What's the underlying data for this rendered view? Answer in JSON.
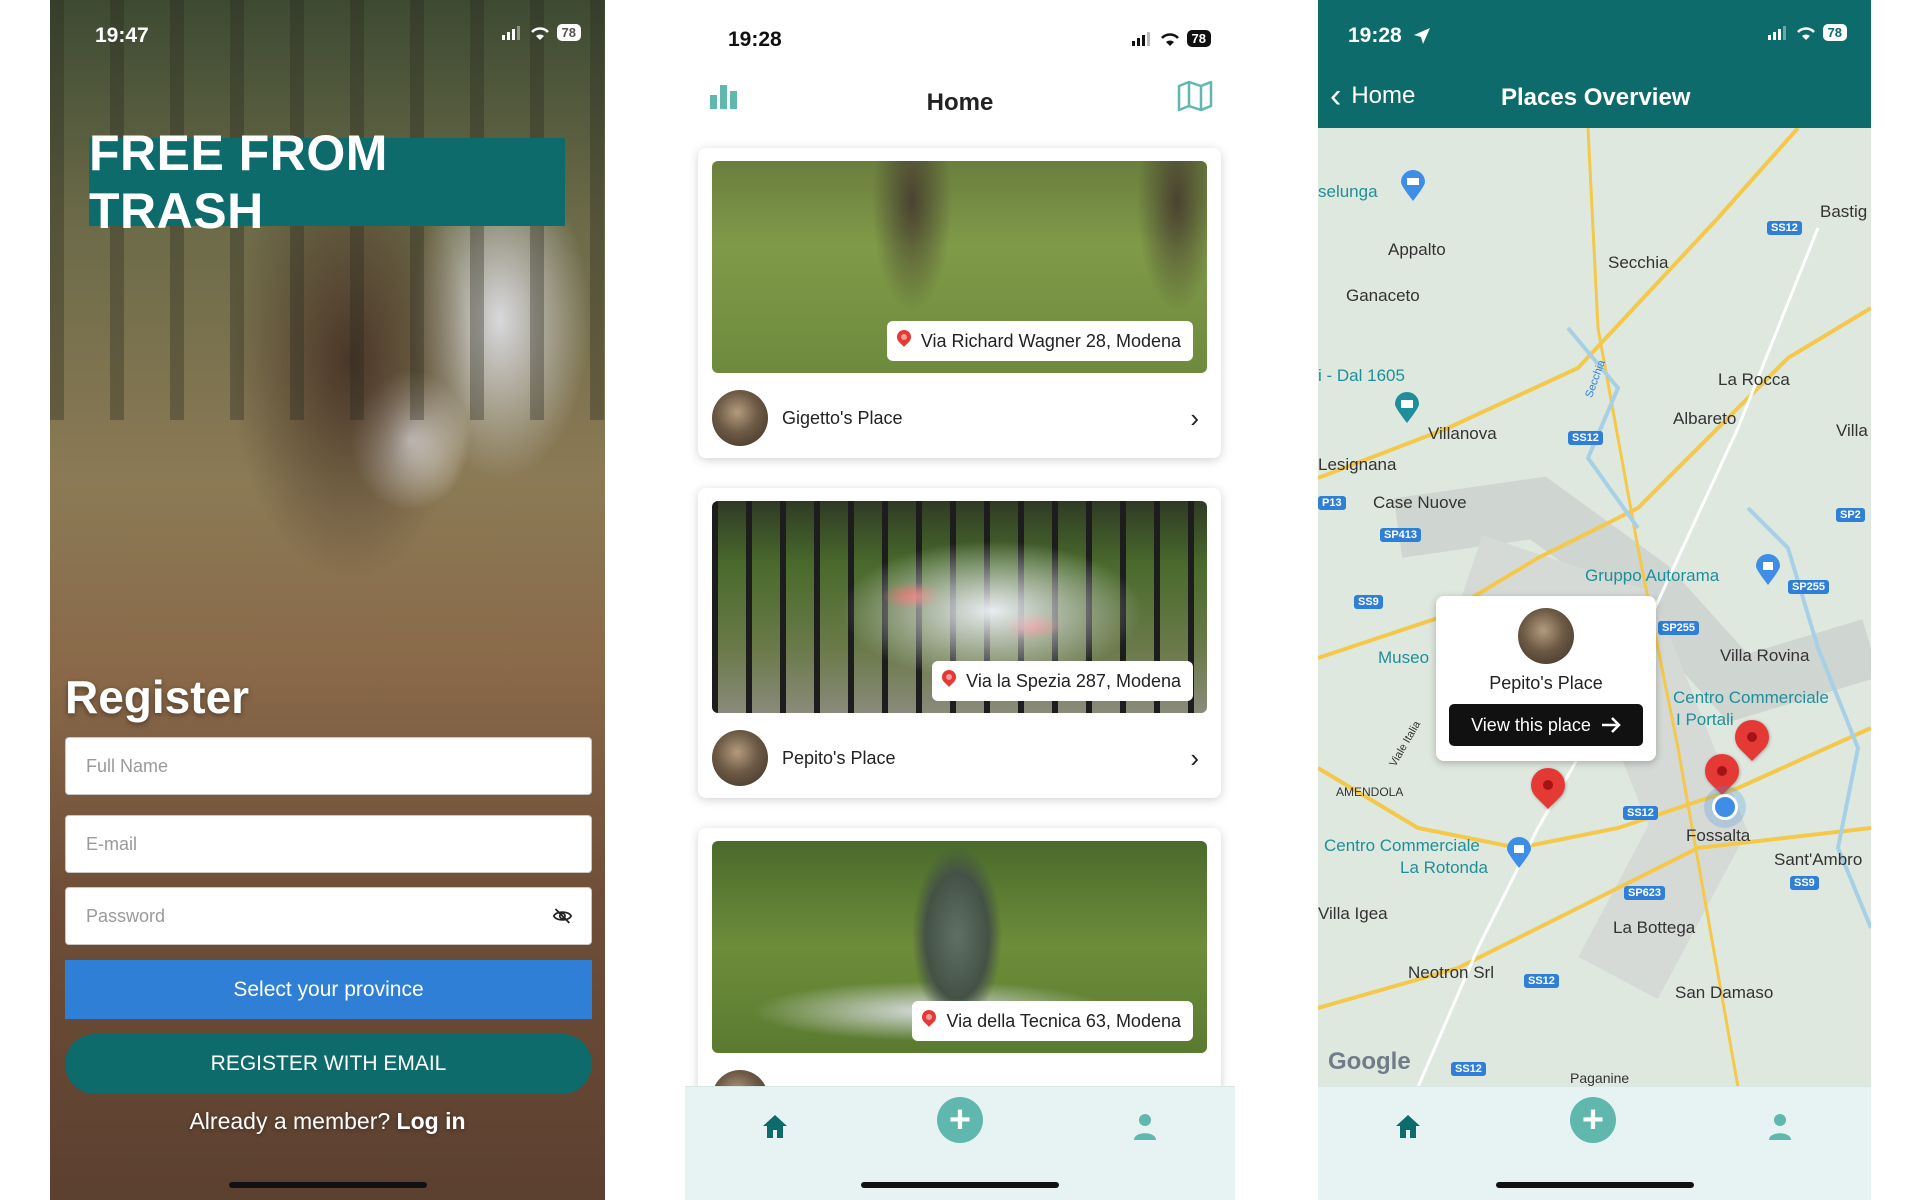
{
  "screen1": {
    "status": {
      "time": "19:47",
      "battery": "78"
    },
    "app_title": "FREE FROM TRASH",
    "form_heading": "Register",
    "full_name_placeholder": "Full Name",
    "email_placeholder": "E-mail",
    "password_placeholder": "Password",
    "province_button": "Select your province",
    "register_button": "REGISTER WITH EMAIL",
    "already_member": "Already a member?",
    "login_link": "Log in"
  },
  "screen2": {
    "status": {
      "time": "19:28",
      "battery": "78"
    },
    "title": "Home",
    "places": [
      {
        "address": "Via Richard Wagner 28, Modena",
        "owner": "Gigetto's Place"
      },
      {
        "address": "Via la Spezia 287, Modena",
        "owner": "Pepito's Place"
      },
      {
        "address": "Via della Tecnica 63, Modena",
        "owner": ""
      }
    ],
    "tabs": [
      "home-icon",
      "add-icon",
      "profile-icon"
    ]
  },
  "screen3": {
    "status": {
      "time": "19:28",
      "battery": "78"
    },
    "back_label": "Home",
    "title": "Places Overview",
    "map_labels": [
      "selunga",
      "Appalto",
      "Ganaceto",
      "Secchia",
      "Bastig",
      "i - Dal 1605",
      "La Rocca",
      "Albareto",
      "Villanova",
      "Villa",
      "Lesignana",
      "Case Nuove",
      "Gruppo Autorama",
      "Museo",
      "Villa Rovina",
      "Centro Commerciale",
      "I Portali",
      "AMENDOLA",
      "Fossalta",
      "Sant'Ambro",
      "Centro Commerciale",
      "La Rotonda",
      "Villa Igea",
      "La Bottega",
      "Neotron Srl",
      "San Damaso",
      "Paganine",
      "Google",
      "Secchia",
      "Viale Italia"
    ],
    "road_shields": [
      "SS12",
      "SS12",
      "SP2",
      "SP413",
      "P13",
      "SS9",
      "SP255",
      "SP255",
      "SS12",
      "SP623",
      "SS9",
      "SS12",
      "SS12"
    ],
    "popup": {
      "name": "Pepito's Place",
      "button": "View this place"
    },
    "tabs": [
      "home-icon",
      "add-icon",
      "profile-icon"
    ]
  }
}
